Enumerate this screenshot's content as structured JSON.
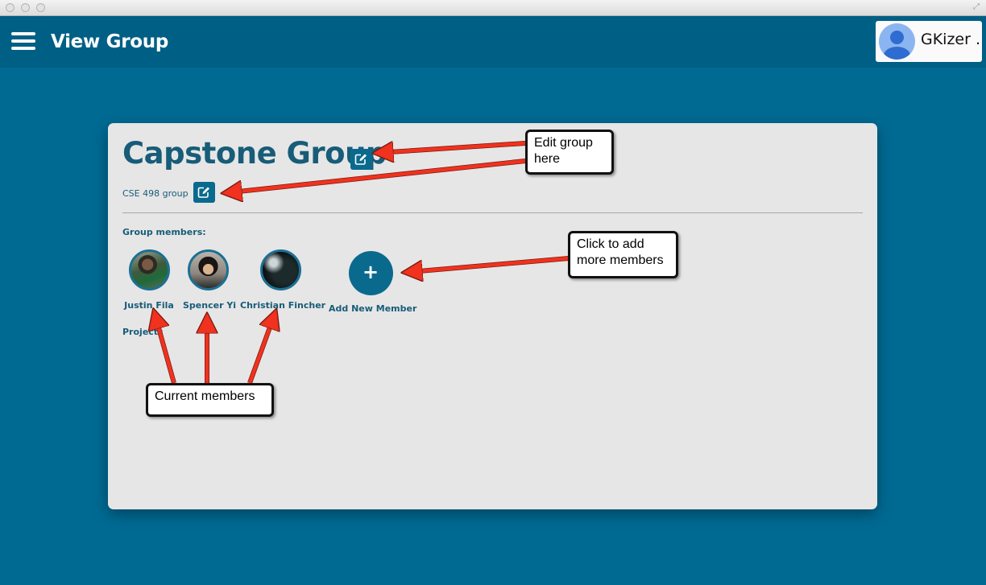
{
  "app": {
    "title": "View Group",
    "user_name": "GKizer ."
  },
  "group": {
    "name": "Capstone Group",
    "description": "CSE 498 group",
    "members_label": "Group members:",
    "projects_label": "Projects",
    "members": [
      {
        "name": "Justin Fila"
      },
      {
        "name": "Spencer Yi"
      },
      {
        "name": "Christian Fincher"
      }
    ],
    "add_member_label": "Add New Member",
    "add_member_symbol": "+"
  },
  "annotations": {
    "edit_group": "Edit group here",
    "add_members": "Click to add more members",
    "current_members": "Current members"
  },
  "colors": {
    "background": "#006a93",
    "appbar": "#005f85",
    "accent": "#0a6a8e",
    "card": "#e6e6e6",
    "text": "#175c78",
    "arrow": "#f0321e"
  },
  "icons": {
    "menu": "hamburger-menu-icon",
    "edit": "edit-pencil-icon",
    "avatar": "user-avatar-icon",
    "fullscreen": "fullscreen-icon"
  }
}
